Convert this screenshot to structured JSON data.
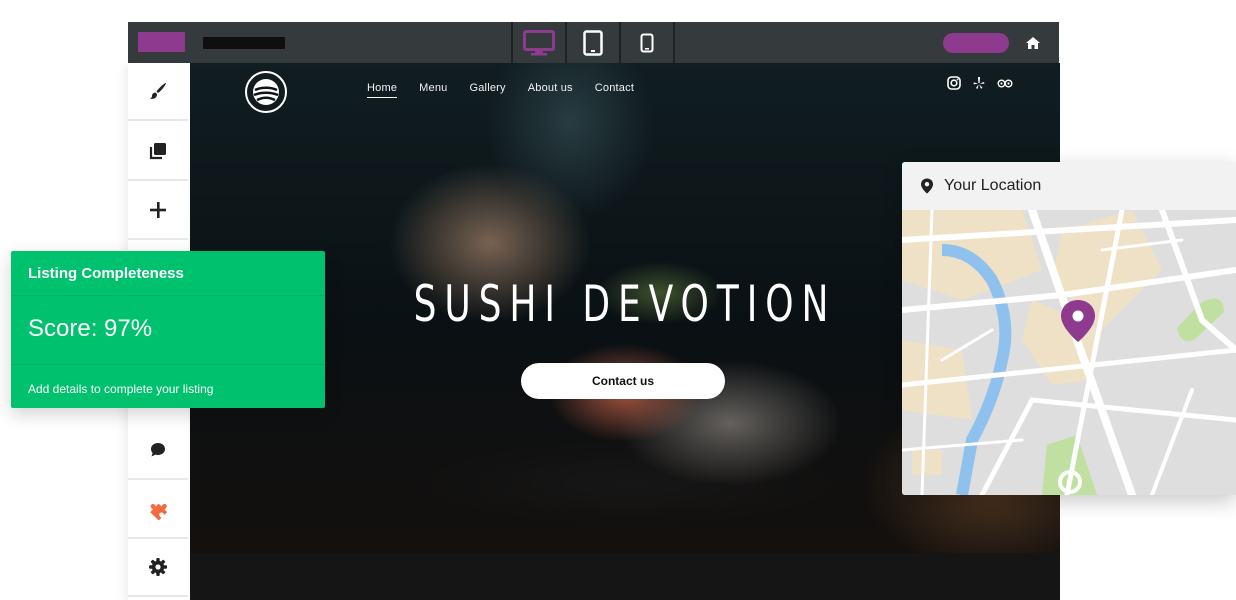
{
  "colors": {
    "accent": "#8e3a8e",
    "topbar": "#353a3d",
    "success": "#00c26e",
    "plugin": "#f26a3d"
  },
  "topbar": {
    "devices": [
      {
        "name": "desktop",
        "icon": "desktop-icon",
        "active": true
      },
      {
        "name": "tablet",
        "icon": "tablet-icon",
        "active": false
      },
      {
        "name": "mobile",
        "icon": "mobile-icon",
        "active": false
      }
    ],
    "home_icon": "home-icon"
  },
  "sidebar": {
    "tools": [
      {
        "icon": "paintbrush-icon"
      },
      {
        "icon": "pages-icon"
      },
      {
        "icon": "plus-icon"
      },
      {
        "icon": "chat-icon"
      },
      {
        "icon": "puzzle-icon"
      },
      {
        "icon": "gear-icon"
      }
    ]
  },
  "site": {
    "nav": [
      "Home",
      "Menu",
      "Gallery",
      "About us",
      "Contact"
    ],
    "active_nav": "Home",
    "social_icons": [
      "instagram-icon",
      "yelp-icon",
      "tripadvisor-icon"
    ],
    "hero_title": "SUSHI DEVOTION",
    "cta_label": "Contact us"
  },
  "listing": {
    "title": "Listing Completeness",
    "score_text": "Score: 97%",
    "score_value": 97,
    "hint": "Add details to complete your listing"
  },
  "map": {
    "title": "Your Location",
    "pin_icon": "map-pin-icon"
  }
}
